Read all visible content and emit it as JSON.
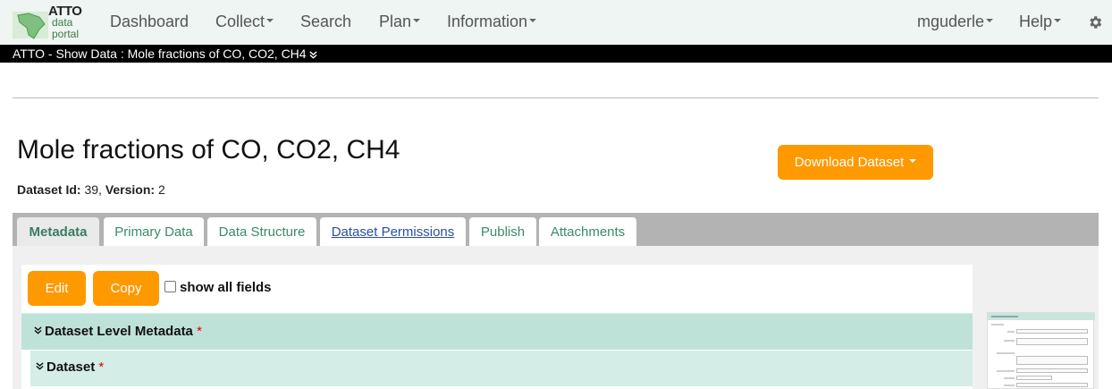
{
  "logo": {
    "line1": "ATTO",
    "line2": "data",
    "line3": "portal"
  },
  "nav": {
    "dashboard": "Dashboard",
    "collect": "Collect",
    "search": "Search",
    "plan": "Plan",
    "information": "Information",
    "user": "mguderle",
    "help": "Help"
  },
  "breadcrumb": "ATTO - Show Data : Mole fractions of CO, CO2, CH4",
  "dataset": {
    "title": "Mole fractions of CO, CO2, CH4",
    "id_label": "Dataset Id:",
    "id_value": "39",
    "version_label": "Version:",
    "version_value": "2"
  },
  "download_button": "Download Dataset",
  "tabs": [
    {
      "label": "Metadata"
    },
    {
      "label": "Primary Data"
    },
    {
      "label": "Data Structure"
    },
    {
      "label": "Dataset Permissions"
    },
    {
      "label": "Publish"
    },
    {
      "label": "Attachments"
    }
  ],
  "actions": {
    "edit": "Edit",
    "copy": "Copy",
    "show_all_fields": "show all fields"
  },
  "sections": {
    "level": "Dataset Level Metadata",
    "dataset": "Dataset",
    "required_mark": "*"
  },
  "colors": {
    "accent": "#ff9900",
    "section": "#bfe2d8",
    "tab_text": "#3a8b6a"
  }
}
